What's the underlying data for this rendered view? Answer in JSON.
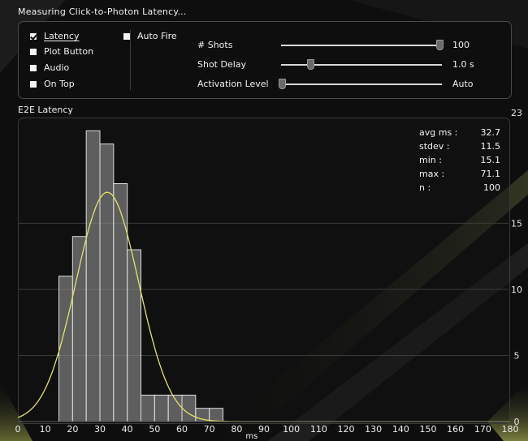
{
  "window": {
    "title": "Measuring Click-to-Photon Latency..."
  },
  "options": [
    {
      "label": "Latency",
      "mnemonic_underline": "L",
      "checked": true
    },
    {
      "label": "Plot Button",
      "checked": false
    },
    {
      "label": "Audio",
      "checked": false
    },
    {
      "label": "On Top",
      "checked": false
    }
  ],
  "auto_fire": {
    "label": "Auto Fire",
    "checked": false
  },
  "sliders": [
    {
      "label": "# Shots",
      "value_text": "100",
      "level": 1.0
    },
    {
      "label": "Shot Delay",
      "value_text": "1.0 s",
      "level": 0.18
    },
    {
      "label": "Activation Level",
      "value_text": "Auto",
      "level": 0.0
    }
  ],
  "section_label": "E2E Latency",
  "stats": [
    {
      "key": "avg ms :",
      "value": "32.7"
    },
    {
      "key": "stdev :",
      "value": "11.5"
    },
    {
      "key": "min :",
      "value": "15.1"
    },
    {
      "key": "max :",
      "value": "71.1"
    },
    {
      "key": "n :",
      "value": "100"
    }
  ],
  "chart_data": {
    "type": "bar",
    "xlabel": "ms",
    "ylabel": "",
    "xlim": [
      0,
      180
    ],
    "ylim": [
      0,
      23
    ],
    "x_ticks": [
      0,
      10,
      20,
      30,
      40,
      50,
      60,
      70,
      80,
      90,
      100,
      110,
      120,
      130,
      140,
      150,
      160,
      170,
      180
    ],
    "y_ticks": [
      0,
      5,
      10,
      15,
      23
    ],
    "bin_width": 5,
    "bins": [
      {
        "x0": 15,
        "count": 11
      },
      {
        "x0": 20,
        "count": 14
      },
      {
        "x0": 25,
        "count": 22
      },
      {
        "x0": 30,
        "count": 21
      },
      {
        "x0": 35,
        "count": 18
      },
      {
        "x0": 40,
        "count": 13
      },
      {
        "x0": 45,
        "count": 2
      },
      {
        "x0": 50,
        "count": 2
      },
      {
        "x0": 55,
        "count": 2
      },
      {
        "x0": 60,
        "count": 2
      },
      {
        "x0": 65,
        "count": 1
      },
      {
        "x0": 70,
        "count": 1
      }
    ],
    "fit_curve": {
      "type": "normal",
      "mean": 32.7,
      "stdev": 11.5,
      "n": 100,
      "color": "#e6e36a"
    },
    "bar_fill": "#8e8e8e",
    "grid": true
  },
  "colors": {
    "accent_curve": "#e6e36a",
    "background": "#0d0e0d"
  }
}
